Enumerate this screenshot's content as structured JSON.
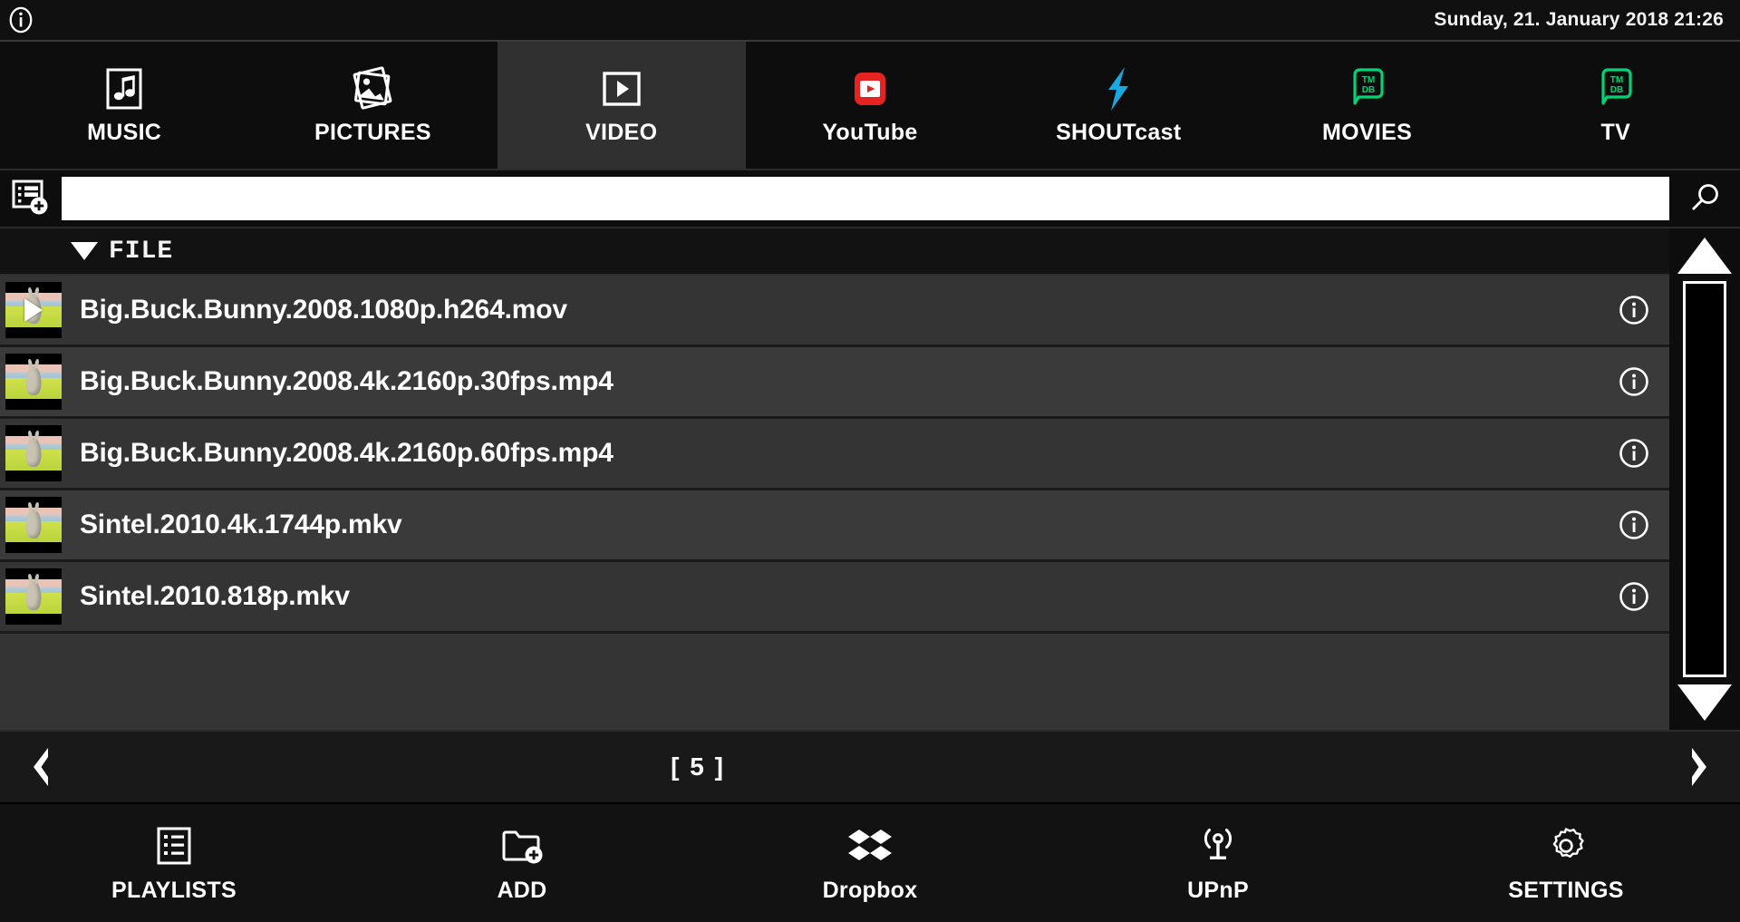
{
  "statusbar": {
    "info_icon": "info-circle-icon",
    "clock": "Sunday, 21. January 2018 21:26"
  },
  "tabs": [
    {
      "label": "MUSIC",
      "icon": "music-note-icon",
      "active": false
    },
    {
      "label": "PICTURES",
      "icon": "photos-icon",
      "active": false
    },
    {
      "label": "VIDEO",
      "icon": "video-play-icon",
      "active": true
    },
    {
      "label": "YouTube",
      "icon": "youtube-icon",
      "active": false
    },
    {
      "label": "SHOUTcast",
      "icon": "shoutcast-bolt-icon",
      "active": false
    },
    {
      "label": "MOVIES",
      "icon": "tmdb-icon",
      "active": false
    },
    {
      "label": "TV",
      "icon": "tmdb-icon",
      "active": false
    }
  ],
  "search": {
    "playlist_add_icon": "playlist-add-icon",
    "value": "",
    "placeholder": "",
    "search_icon": "search-icon"
  },
  "list": {
    "sort_caret": "caret-down-icon",
    "column_header": "FILE",
    "rows": [
      {
        "name": "Big.Buck.Bunny.2008.1080p.h264.mov",
        "playing": true,
        "info_icon": "info-circle-icon"
      },
      {
        "name": "Big.Buck.Bunny.2008.4k.2160p.30fps.mp4",
        "playing": false,
        "info_icon": "info-circle-icon"
      },
      {
        "name": "Big.Buck.Bunny.2008.4k.2160p.60fps.mp4",
        "playing": false,
        "info_icon": "info-circle-icon"
      },
      {
        "name": "Sintel.2010.4k.1744p.mkv",
        "playing": false,
        "info_icon": "info-circle-icon"
      },
      {
        "name": "Sintel.2010.818p.mkv",
        "playing": false,
        "info_icon": "info-circle-icon"
      }
    ]
  },
  "scrollbar": {
    "up_icon": "triangle-up-icon",
    "down_icon": "triangle-down-icon"
  },
  "pager": {
    "prev_icon": "chevron-left-icon",
    "next_icon": "chevron-right-icon",
    "count_label": "[ 5 ]"
  },
  "bottombar": [
    {
      "label": "PLAYLISTS",
      "icon": "playlist-icon"
    },
    {
      "label": "ADD",
      "icon": "folder-add-icon"
    },
    {
      "label": "Dropbox",
      "icon": "dropbox-icon"
    },
    {
      "label": "UPnP",
      "icon": "upnp-antenna-icon"
    },
    {
      "label": "SETTINGS",
      "icon": "gear-icon"
    }
  ],
  "colors": {
    "background": "#101010",
    "row": "#343434",
    "row_alt": "#3a3a3a",
    "active_tab": "#303030",
    "youtube_red": "#e52421",
    "shoutcast_blue": "#18a9e0",
    "tmdb_green": "#01d277",
    "text": "#ffffff"
  }
}
